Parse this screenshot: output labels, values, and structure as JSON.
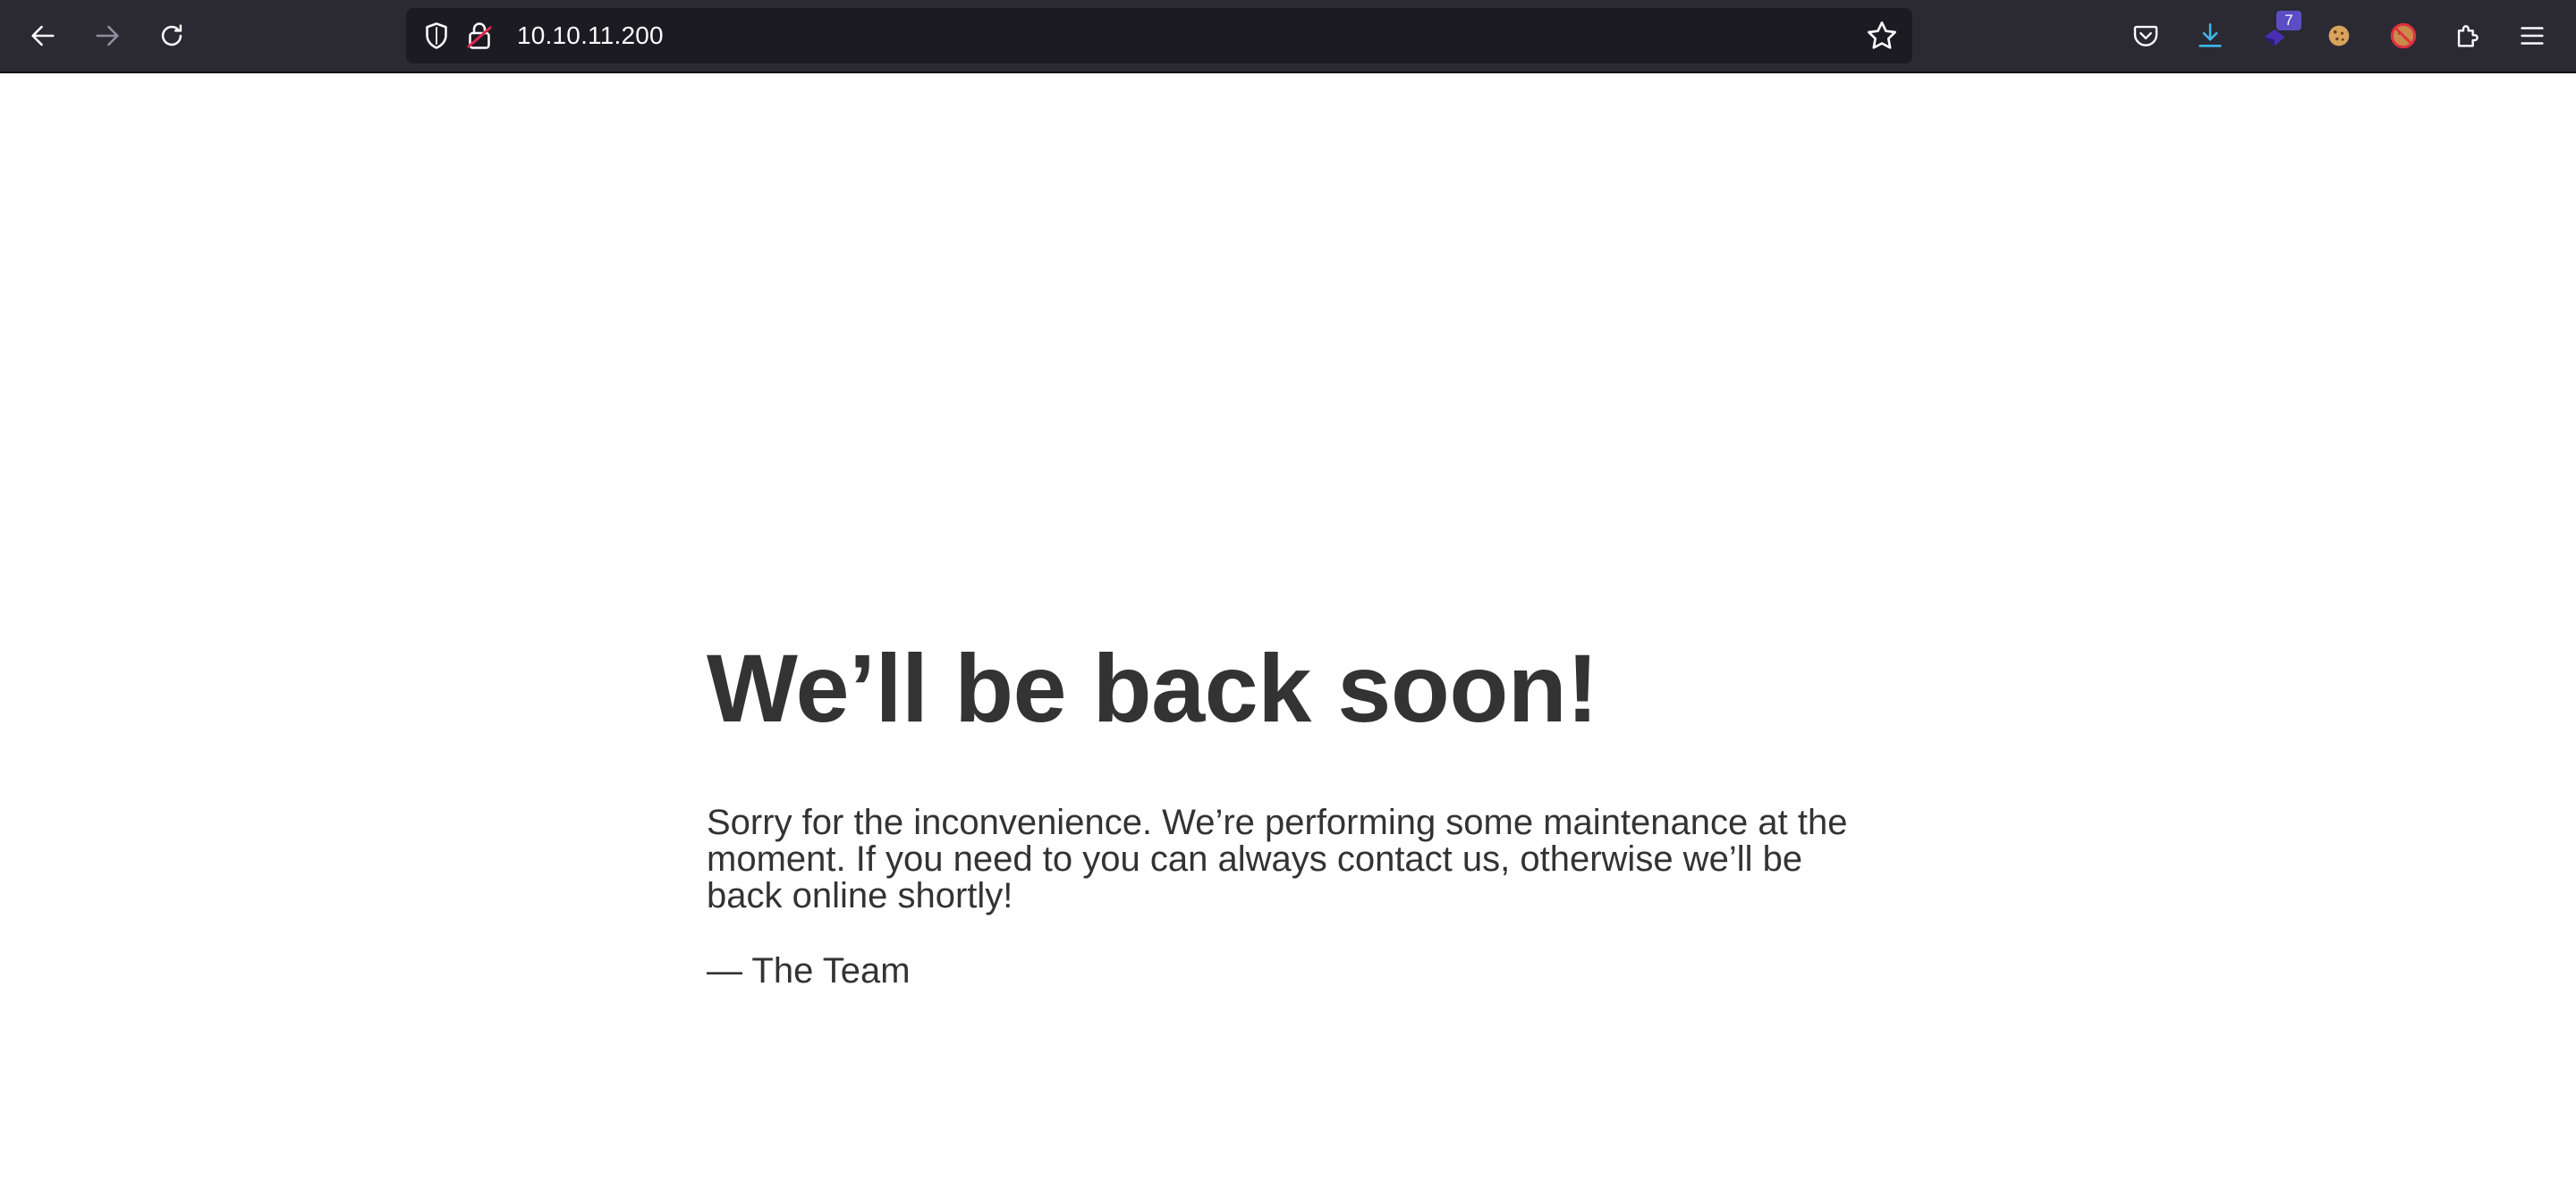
{
  "browser": {
    "url": "10.10.11.200",
    "extension_badge": "7",
    "accent_color": "#3fb7e8"
  },
  "icons": {
    "back": "back-arrow-icon",
    "forward": "forward-arrow-icon",
    "reload": "reload-icon",
    "shield": "tracking-protection-shield-icon",
    "lock": "insecure-lock-icon",
    "bookmark": "bookmark-star-icon",
    "pocket": "pocket-icon",
    "downloads": "download-icon",
    "extension1": "extension-shield-icon",
    "extension2": "cookie-icon",
    "extension3": "extension-cookie-blocked-icon",
    "extensions": "extensions-puzzle-icon",
    "menu": "hamburger-menu-icon"
  },
  "page": {
    "heading": "We’ll be back soon!",
    "message": "Sorry for the inconvenience. We’re performing some maintenance at the moment. If you need to you can always contact us, otherwise we’ll be back online shortly!",
    "signature": "— The Team"
  }
}
